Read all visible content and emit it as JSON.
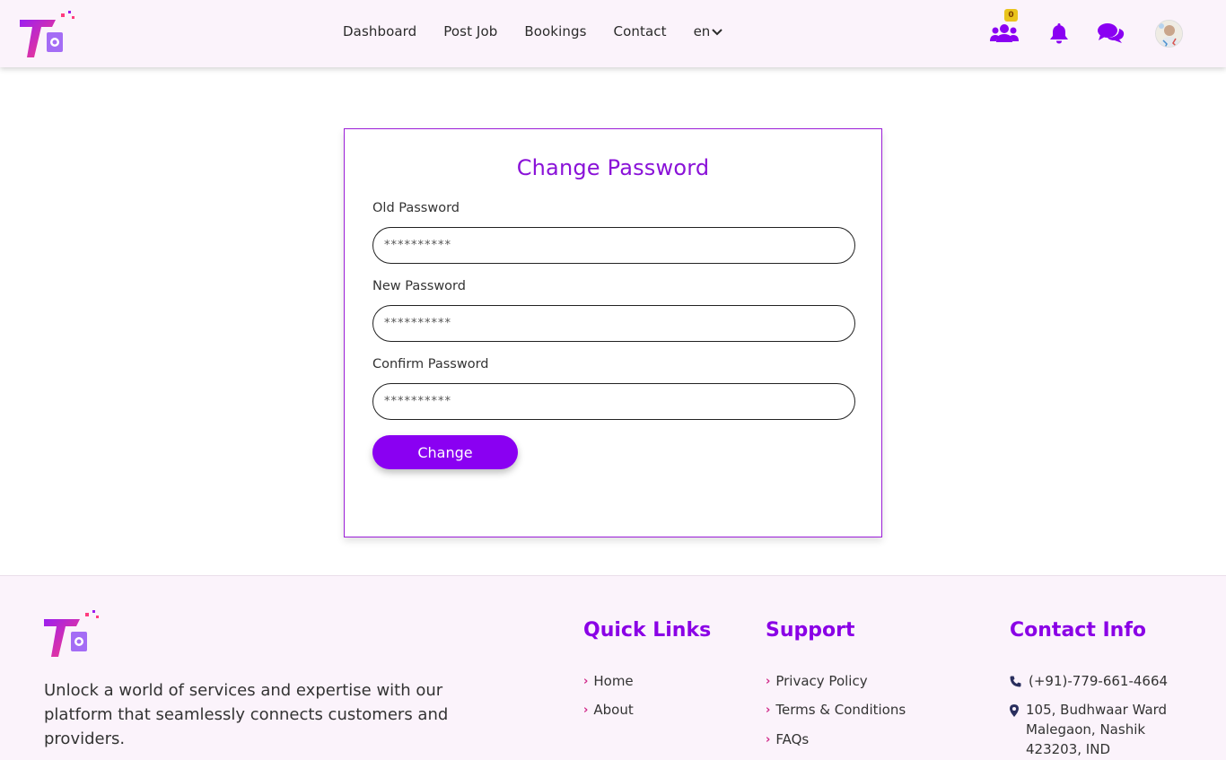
{
  "header": {
    "logo": "brand-logo",
    "nav": [
      "Dashboard",
      "Post Job",
      "Bookings",
      "Contact"
    ],
    "language": "en",
    "team_badge": "0",
    "icons": [
      "users-icon",
      "bell-icon",
      "chat-icon",
      "avatar"
    ]
  },
  "form": {
    "title": "Change Password",
    "old_label": "Old Password",
    "old_placeholder": "**********",
    "new_label": "New Password",
    "new_placeholder": "**********",
    "confirm_label": "Confirm Password",
    "confirm_placeholder": "**********",
    "submit": "Change"
  },
  "footer": {
    "tagline": "Unlock a world of services and expertise with our platform that seamlessly connects customers and providers.",
    "quick_links": {
      "title": "Quick Links",
      "items": [
        "Home",
        "About"
      ]
    },
    "support": {
      "title": "Support",
      "items": [
        "Privacy Policy",
        "Terms & Conditions",
        "FAQs"
      ]
    },
    "contact": {
      "title": "Contact Info",
      "phone": "(+91)-779-661-4664",
      "address": [
        "105, Budhwaar Ward",
        "Malegaon, Nashik",
        "423203, IND"
      ]
    }
  },
  "colors": {
    "accent": "#8a00f2",
    "header_bg": "#fbf3fb",
    "badge": "#e9c41c",
    "chevron": "#d12a8a"
  }
}
